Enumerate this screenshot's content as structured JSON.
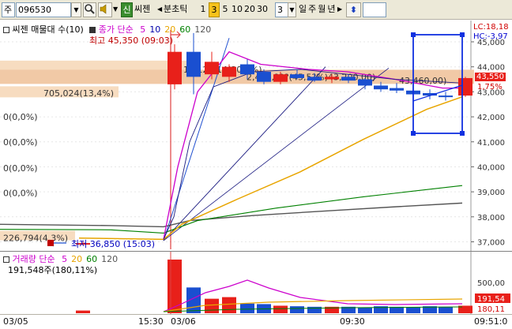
{
  "toolbar": {
    "market": "주",
    "code": "096530",
    "stock_name": "씨젠",
    "new_badge": "신",
    "interval_unit": "분초틱",
    "interval_options": [
      "1",
      "3",
      "5",
      "10",
      "20",
      "30"
    ],
    "interval_selected": "3",
    "period_value": "3",
    "period_tabs": [
      "일",
      "주",
      "월",
      "년"
    ]
  },
  "price_panel": {
    "legend_prefix": "씨젠 매물대 수(10)",
    "ma_legend": {
      "label": "종가 단순",
      "periods": [
        "5",
        "10",
        "20",
        "60",
        "120"
      ],
      "colors": [
        "#cc00cc",
        "#0000aa",
        "#e8a500",
        "#008000",
        "#555555"
      ]
    },
    "high_marker": "최고 45,350 (09:03)",
    "low_marker": "최저 36,850 (15:03)",
    "volume_profile": [
      {
        "label": "1,612,414(30,7%)"
      },
      {
        "label": "2,400,?2?(45,5?%)43,200,00)"
      },
      {
        "label": "705,024(13,4%)"
      },
      {
        "label": "0(0,0%)"
      },
      {
        "label": "0(0,0%)"
      },
      {
        "label": "0(0,0%)"
      },
      {
        "label": "0(0,0%)"
      },
      {
        "label": "226,794(4,3%)"
      }
    ],
    "value_note": "43,460,00)",
    "lc": "LC:18,18",
    "hc": "HC:-3,97",
    "current_price": "43,550",
    "current_change": "1,75%",
    "y_labels": [
      "45,000",
      "44,000",
      "43,000",
      "42,000",
      "41,000",
      "40,000",
      "39,000",
      "38,000",
      "37,000"
    ]
  },
  "volume_panel": {
    "title": "거래량 단순",
    "periods": [
      "5",
      "20",
      "60",
      "120"
    ],
    "colors": [
      "#cc00cc",
      "#e8a500",
      "#008000",
      "#555555"
    ],
    "value": "191,548주(180,11%)",
    "y_labels": [
      "500,00",
      "191,54",
      "180,11"
    ]
  },
  "date_axis": {
    "labels": [
      "03/05",
      "15:30",
      "03/06",
      "09:30",
      "09:51:0"
    ]
  },
  "chart_data": {
    "type": "candlestick",
    "x": [
      "03/05 prev",
      "03/06 09:00",
      "09:03",
      "09:06",
      "09:09",
      "09:12",
      "09:15",
      "09:18",
      "09:21",
      "09:24",
      "09:27",
      "09:30",
      "09:33",
      "09:36",
      "09:39",
      "09:42",
      "09:45",
      "09:48",
      "09:51"
    ],
    "ylim": [
      36700,
      45600
    ],
    "candles": [
      {
        "o": 36950,
        "h": 37000,
        "l": 36850,
        "c": 36950
      },
      {
        "o": 43300,
        "h": 44900,
        "l": 43100,
        "c": 44600
      },
      {
        "o": 44600,
        "h": 45350,
        "l": 42900,
        "c": 43600
      },
      {
        "o": 43700,
        "h": 44600,
        "l": 43500,
        "c": 44200
      },
      {
        "o": 43600,
        "h": 44100,
        "l": 43400,
        "c": 44000
      },
      {
        "o": 44100,
        "h": 44300,
        "l": 43500,
        "c": 43700
      },
      {
        "o": 43800,
        "h": 43900,
        "l": 43300,
        "c": 43400
      },
      {
        "o": 43400,
        "h": 43800,
        "l": 43300,
        "c": 43700
      },
      {
        "o": 43700,
        "h": 43900,
        "l": 43500,
        "c": 43550
      },
      {
        "o": 43600,
        "h": 43750,
        "l": 43400,
        "c": 43450
      },
      {
        "o": 43500,
        "h": 43700,
        "l": 43350,
        "c": 43600
      },
      {
        "o": 43600,
        "h": 43700,
        "l": 43350,
        "c": 43450
      },
      {
        "o": 43500,
        "h": 43550,
        "l": 43100,
        "c": 43250
      },
      {
        "o": 43250,
        "h": 43400,
        "l": 43000,
        "c": 43100
      },
      {
        "o": 43150,
        "h": 43350,
        "l": 42950,
        "c": 43050
      },
      {
        "o": 43050,
        "h": 43200,
        "l": 42800,
        "c": 42900
      },
      {
        "o": 42950,
        "h": 43100,
        "l": 42700,
        "c": 42850
      },
      {
        "o": 42850,
        "h": 43000,
        "l": 42650,
        "c": 42800
      },
      {
        "o": 42850,
        "h": 43600,
        "l": 42800,
        "c": 43550
      }
    ],
    "volume": [
      5,
      100,
      48,
      27,
      30,
      18,
      17,
      14,
      13,
      12,
      12,
      12,
      11,
      13,
      12,
      11,
      13,
      12,
      14
    ]
  }
}
